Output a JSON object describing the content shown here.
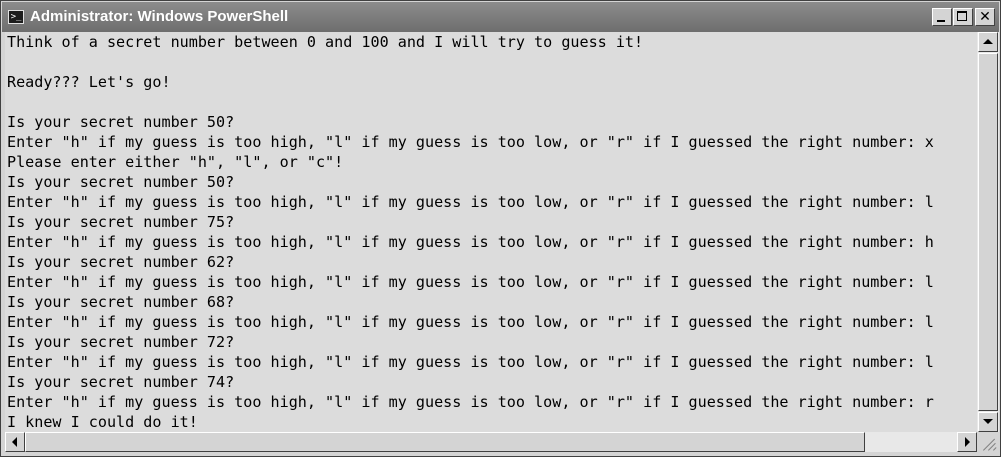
{
  "window": {
    "title": "Administrator: Windows PowerShell",
    "icon": "powershell-icon",
    "icon_glyph": ">_"
  },
  "controls": {
    "minimize_icon": "minimize-icon",
    "maximize_icon": "maximize-icon",
    "close_icon": "close-icon",
    "close_glyph": "✕"
  },
  "console": {
    "lines": [
      "Think of a secret number between 0 and 100 and I will try to guess it!",
      "",
      "Ready??? Let's go!",
      "",
      "Is your secret number 50?",
      "Enter \"h\" if my guess is too high, \"l\" if my guess is too low, or \"r\" if I guessed the right number: x",
      "Please enter either \"h\", \"l\", or \"c\"!",
      "Is your secret number 50?",
      "Enter \"h\" if my guess is too high, \"l\" if my guess is too low, or \"r\" if I guessed the right number: l",
      "Is your secret number 75?",
      "Enter \"h\" if my guess is too high, \"l\" if my guess is too low, or \"r\" if I guessed the right number: h",
      "Is your secret number 62?",
      "Enter \"h\" if my guess is too high, \"l\" if my guess is too low, or \"r\" if I guessed the right number: l",
      "Is your secret number 68?",
      "Enter \"h\" if my guess is too high, \"l\" if my guess is too low, or \"r\" if I guessed the right number: l",
      "Is your secret number 72?",
      "Enter \"h\" if my guess is too high, \"l\" if my guess is too low, or \"r\" if I guessed the right number: l",
      "Is your secret number 74?",
      "Enter \"h\" if my guess is too high, \"l\" if my guess is too low, or \"r\" if I guessed the right number: r",
      "I knew I could do it!"
    ]
  },
  "scrollbars": {
    "up_icon": "arrow-up-icon",
    "down_icon": "arrow-down-icon",
    "left_icon": "arrow-left-icon",
    "right_icon": "arrow-right-icon"
  },
  "colors": {
    "console_background": "#dcdcdc",
    "console_text": "#000000",
    "titlebar": "#7d7d7d"
  }
}
